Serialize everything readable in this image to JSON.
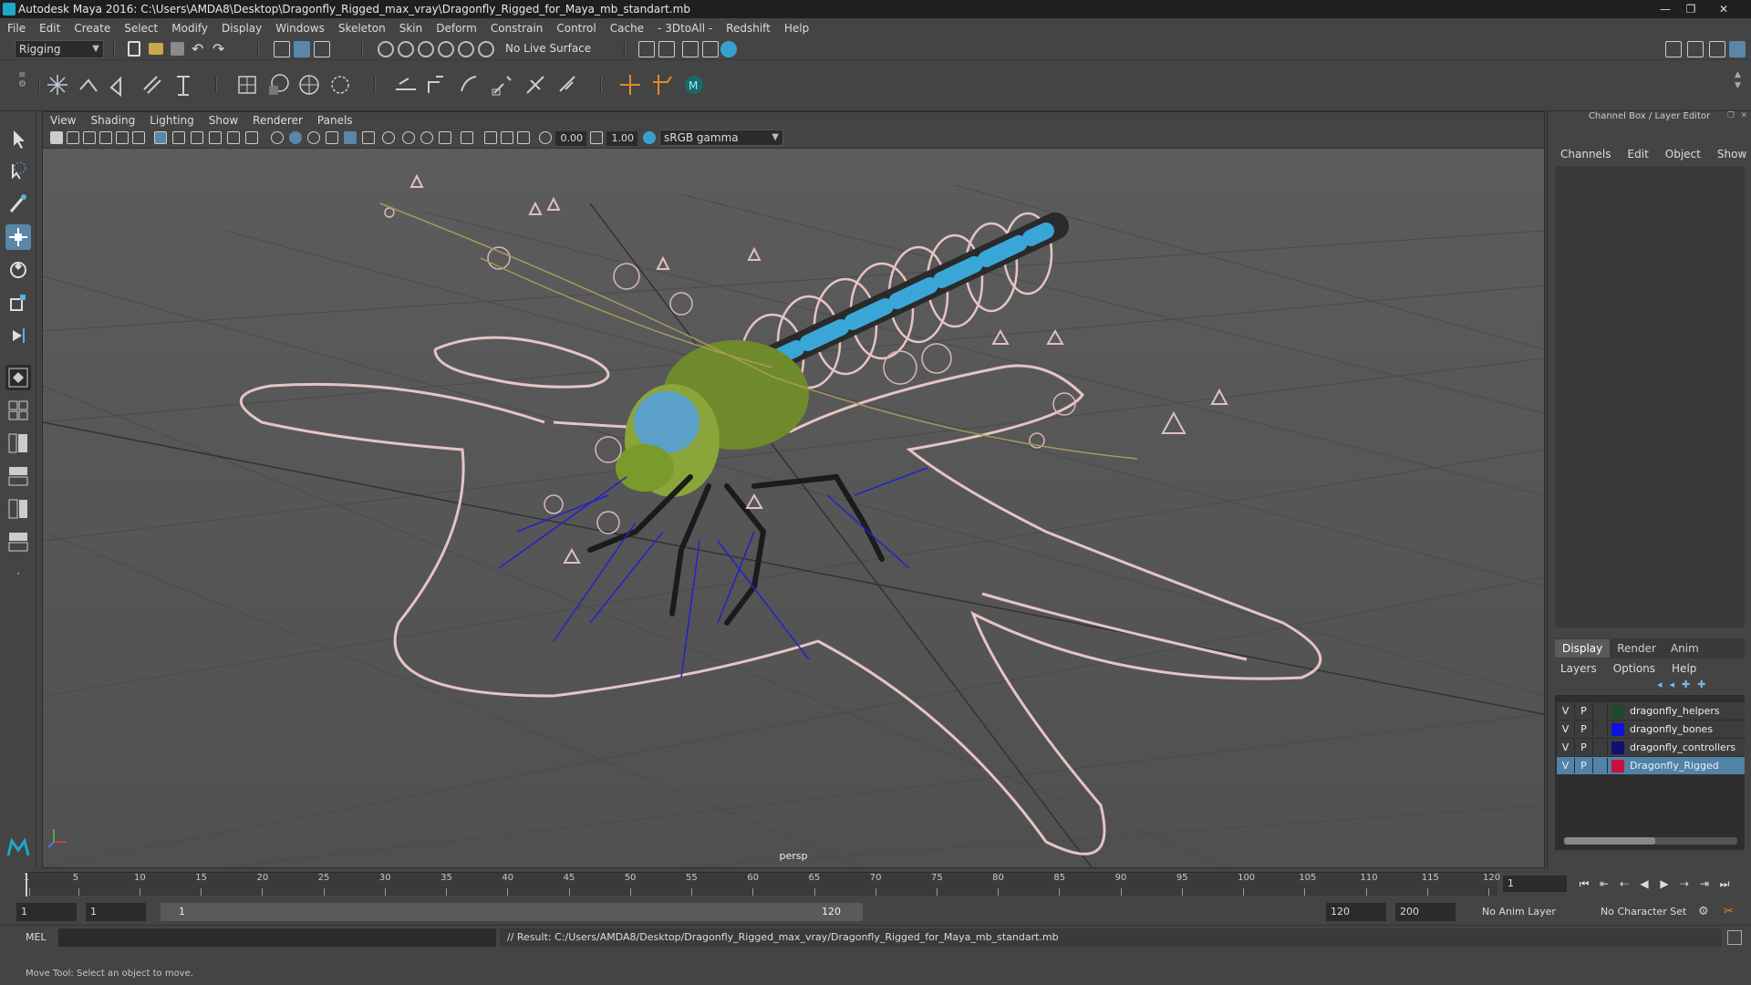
{
  "window": {
    "title": "Autodesk Maya 2016: C:\\Users\\AMDA8\\Desktop\\Dragonfly_Rigged_max_vray\\Dragonfly_Rigged_for_Maya_mb_standart.mb",
    "minimize": "—",
    "maximize": "❐",
    "close": "✕"
  },
  "menubar": [
    "File",
    "Edit",
    "Create",
    "Select",
    "Modify",
    "Display",
    "Windows",
    "Skeleton",
    "Skin",
    "Deform",
    "Constrain",
    "Control",
    "Cache",
    "- 3DtoAll -",
    "Redshift",
    "Help"
  ],
  "statusline": {
    "menuset": "Rigging",
    "live_surface": "No Live Surface"
  },
  "viewport": {
    "menu": [
      "View",
      "Shading",
      "Lighting",
      "Show",
      "Renderer",
      "Panels"
    ],
    "exposure": "0.00",
    "gamma": "1.00",
    "color_space": "sRGB gamma",
    "camera": "persp"
  },
  "rightpanel": {
    "title": "Channel Box / Layer Editor",
    "channel_menu": [
      "Channels",
      "Edit",
      "Object",
      "Show"
    ],
    "layer_tabs": [
      "Display",
      "Render",
      "Anim"
    ],
    "layer_menu": [
      "Layers",
      "Options",
      "Help"
    ],
    "layers": [
      {
        "v": "V",
        "p": "P",
        "name": "dragonfly_helpers",
        "color": "#1c4a2a",
        "selected": false
      },
      {
        "v": "V",
        "p": "P",
        "name": "dragonfly_bones",
        "color": "#1010e0",
        "selected": false
      },
      {
        "v": "V",
        "p": "P",
        "name": "dragonfly_controllers",
        "color": "#101070",
        "selected": false
      },
      {
        "v": "V",
        "p": "P",
        "name": "Dragonfly_Rigged",
        "color": "#c8103a",
        "selected": true
      }
    ]
  },
  "timeslider": {
    "ticks": [
      "1",
      "5",
      "10",
      "15",
      "20",
      "25",
      "30",
      "35",
      "40",
      "45",
      "50",
      "55",
      "60",
      "65",
      "70",
      "75",
      "80",
      "85",
      "90",
      "95",
      "100",
      "105",
      "110",
      "115",
      "120"
    ],
    "current_frame": "1"
  },
  "rangeslider": {
    "start": "1",
    "range_start": "1",
    "range_bar_start": "1",
    "range_bar_end": "120",
    "range_end": "120",
    "end": "200",
    "anim_layer": "No Anim Layer",
    "character_set": "No Character Set"
  },
  "cmdline": {
    "label": "MEL",
    "result": "// Result: C:/Users/AMDA8/Desktop/Dragonfly_Rigged_max_vray/Dragonfly_Rigged_for_Maya_mb_standart.mb"
  },
  "helpline": "Move Tool: Select an object to move."
}
